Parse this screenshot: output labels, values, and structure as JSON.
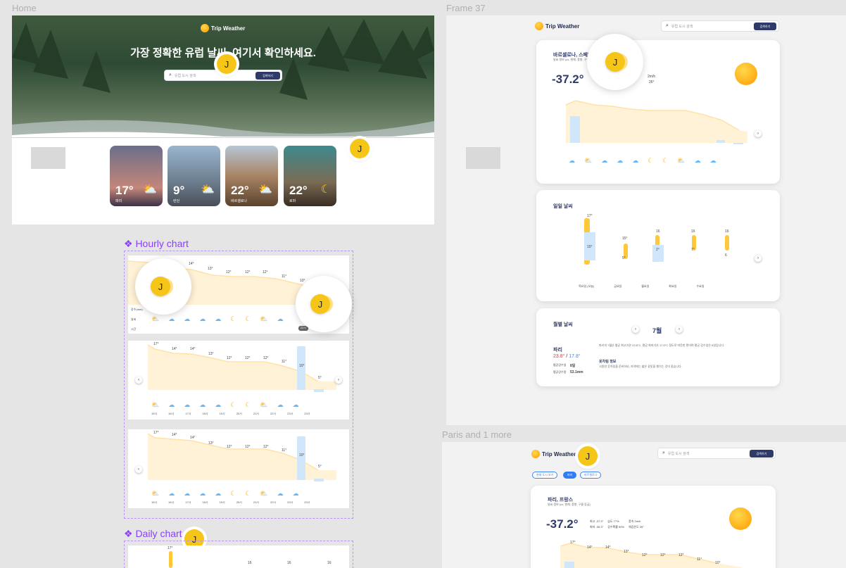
{
  "frames": {
    "home_label": "Home",
    "frame37_label": "Frame 37",
    "paris_label": "Paris and 1 more"
  },
  "brand": {
    "name": "Trip Weather"
  },
  "home": {
    "hero_title": "가장 정확한 유럽 날씨, 여기서 확인하세요.",
    "search_placeholder": "유럽 도시 검색",
    "search_button": "검색하기",
    "cities": [
      {
        "temp": "17°",
        "name": "파리",
        "icon": "cloud-rain-sun-icon"
      },
      {
        "temp": "9°",
        "name": "런던",
        "icon": "cloud-rain-sun-icon"
      },
      {
        "temp": "22°",
        "name": "바르셀로나",
        "icon": "cloud-rain-sun-icon"
      },
      {
        "temp": "22°",
        "name": "로마",
        "icon": "moon-icon"
      }
    ]
  },
  "components": {
    "hourly_chart": "❖ Hourly chart",
    "daily_chart": "❖ Daily chart"
  },
  "hourly": {
    "temps": [
      "17°",
      "14°",
      "14°",
      "13°",
      "12°",
      "12°",
      "12°",
      "11°",
      "10°",
      "5°"
    ],
    "precip": [
      "0",
      "0.8",
      "0",
      "0",
      "0",
      "0",
      "0",
      "0",
      "1.8",
      "0.1"
    ],
    "times": [
      "15시",
      "16시",
      "17시",
      "18시",
      "19시",
      "20시",
      "21시",
      "22시",
      "23시",
      "23시"
    ],
    "row_labels": [
      "강수(mm)",
      "날씨",
      "시간"
    ]
  },
  "frame37": {
    "search_placeholder": "유럽 도시 검색",
    "search_button": "검색하기",
    "city_title": "바르셀로나, 스페인",
    "city_sub": "날씨 정보 (cx, 현재, 풍향, 구름 등급)",
    "current_temp": "-37.2°",
    "wind": "2m/h",
    "feel": "26°",
    "daily_title": "일일 날씨",
    "daily_high": [
      "17°",
      "15°",
      "16",
      "16",
      "16"
    ],
    "daily_low": [
      "15°",
      "5°",
      "2°",
      "7°",
      "6"
    ],
    "daily_days": [
      "목요일 (오늘)",
      "금요일",
      "월요일",
      "화요일",
      "수요일"
    ],
    "monthly_title": "월별 날씨",
    "month": "7월",
    "paris_label": "파리",
    "paris_temp_high": "23.8°",
    "paris_temp_low": "17.8°",
    "rain_days_label": "평균강수일",
    "rain_days": "8일",
    "rain_amount_label": "평균강수량",
    "rain_amount": "53.1mm",
    "desc_title": "옷차림 정보",
    "desc1": "파리의 7월은 평균 최고기온 23.8°C, 평균 최저기온 17.8°C 정도로 따뜻한 편이며 평균 강수일은 8일입니다.",
    "desc2": "시원한 옷차림을 준비하되, 저녁에는 얇은 겉옷을 챙기는 것이 좋습니다."
  },
  "paris_frame": {
    "search_placeholder": "유럽 도시 검색",
    "search_button": "검색하기",
    "chips": [
      "현재 도시 보기",
      "파리",
      "바르셀로나"
    ],
    "city_title": "파리, 프랑스",
    "city_sub": "날씨 정보 (cx, 현재, 풍향, 구름 등급)",
    "current_temp": "-37.2°",
    "stats": [
      "최고 -37.3°",
      "습도 77%",
      "풍속 2m/h",
      "최저 -35.3°",
      "강수확률 90%",
      "체감온도 26°"
    ],
    "temps": [
      "17°",
      "14°",
      "14°",
      "13°",
      "12°",
      "12°",
      "12°",
      "11°",
      "10°"
    ]
  },
  "avatar_letter": "J",
  "colors": {
    "accent": "#8a3ffc",
    "navy": "#2f3a6b",
    "sun": "#ffb000",
    "rain": "#6ab7f5"
  }
}
